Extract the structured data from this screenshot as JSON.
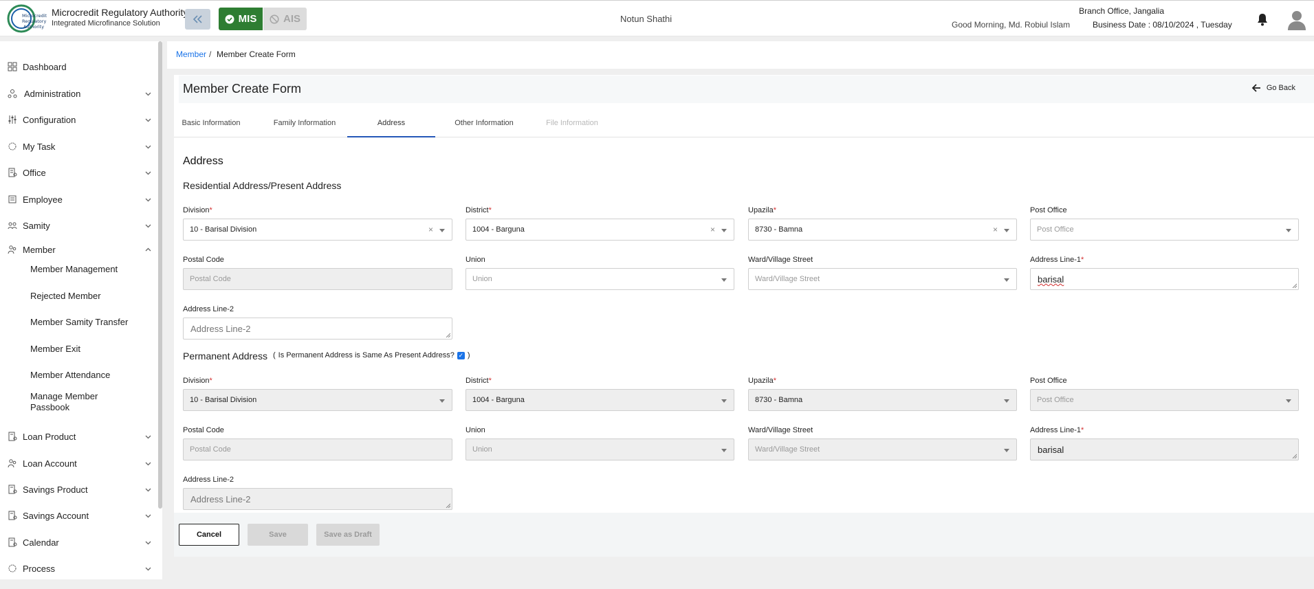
{
  "header": {
    "org_title": "Microcredit Regulatory Authority",
    "org_subtitle": "Integrated Microfinance Solution",
    "logo_text": "Microcredit Regulatory Authority",
    "mode_mis": "MIS",
    "mode_ais": "AIS",
    "center_text": "Notun Shathi",
    "greeting": "Good Morning, Md. Robiul Islam",
    "branch": "Branch Office, Jangalia",
    "business_date": "Business Date : 08/10/2024 , Tuesday"
  },
  "sidebar": {
    "items": [
      {
        "label": "Dashboard",
        "icon": "dashboard-icon"
      },
      {
        "label": "Administration",
        "icon": "administration-icon"
      },
      {
        "label": "Configuration",
        "icon": "configuration-icon"
      },
      {
        "label": "My Task",
        "icon": "task-icon"
      },
      {
        "label": "Office",
        "icon": "office-icon"
      },
      {
        "label": "Employee",
        "icon": "employee-icon"
      },
      {
        "label": "Samity",
        "icon": "samity-icon"
      },
      {
        "label": "Member",
        "icon": "member-icon"
      },
      {
        "label": "Loan Product",
        "icon": "loan-product-icon"
      },
      {
        "label": "Loan Account",
        "icon": "loan-account-icon"
      },
      {
        "label": "Savings Product",
        "icon": "savings-product-icon"
      },
      {
        "label": "Savings Account",
        "icon": "savings-account-icon"
      },
      {
        "label": "Calendar",
        "icon": "calendar-icon"
      },
      {
        "label": "Process",
        "icon": "process-icon"
      }
    ],
    "member_sub": [
      "Member Management",
      "Rejected Member",
      "Member Samity Transfer",
      "Member Exit",
      "Member Attendance",
      "Manage Member Passbook"
    ]
  },
  "breadcrumb": {
    "parent": "Member",
    "separator": "/",
    "current": "Member Create Form"
  },
  "page": {
    "title": "Member Create Form",
    "go_back": "Go Back"
  },
  "tabs": [
    "Basic Information",
    "Family Information",
    "Address",
    "Other Information",
    "File Information"
  ],
  "form": {
    "section_title": "Address",
    "present_title": "Residential Address/Present Address",
    "permanent_title": "Permanent Address",
    "permanent_note_open": "(",
    "permanent_note": "Is Permanent Address is Same As Present Address?",
    "permanent_note_close": ")",
    "labels": {
      "division": "Division",
      "district": "District",
      "upazila": "Upazila",
      "post_office": "Post Office",
      "postal_code": "Postal Code",
      "union": "Union",
      "ward": "Ward/Village Street",
      "address1": "Address Line-1",
      "address2": "Address Line-2",
      "required_mark": "*"
    },
    "present": {
      "division": "10 - Barisal Division",
      "district": "1004 - Barguna",
      "upazila": "8730 - Bamna",
      "post_office_ph": "Post Office",
      "postal_code_ph": "Postal Code",
      "union_ph": "Union",
      "ward_ph": "Ward/Village Street",
      "address1": "barisal",
      "address2_ph": "Address Line-2",
      "clear": "×"
    },
    "permanent": {
      "division": "10 - Barisal Division",
      "district": "1004 - Barguna",
      "upazila": "8730 - Bamna",
      "post_office_ph": "Post Office",
      "postal_code_ph": "Postal Code",
      "union_ph": "Union",
      "ward_ph": "Ward/Village Street",
      "address1": "barisal",
      "address2_ph": "Address Line-2",
      "same_checked": true
    }
  },
  "buttons": {
    "cancel": "Cancel",
    "save": "Save",
    "save_draft": "Save as Draft"
  },
  "colors": {
    "accent": "#2e7d32",
    "link": "#1a73e8",
    "tab_active": "#2457b8",
    "required": "#d32f2f"
  }
}
